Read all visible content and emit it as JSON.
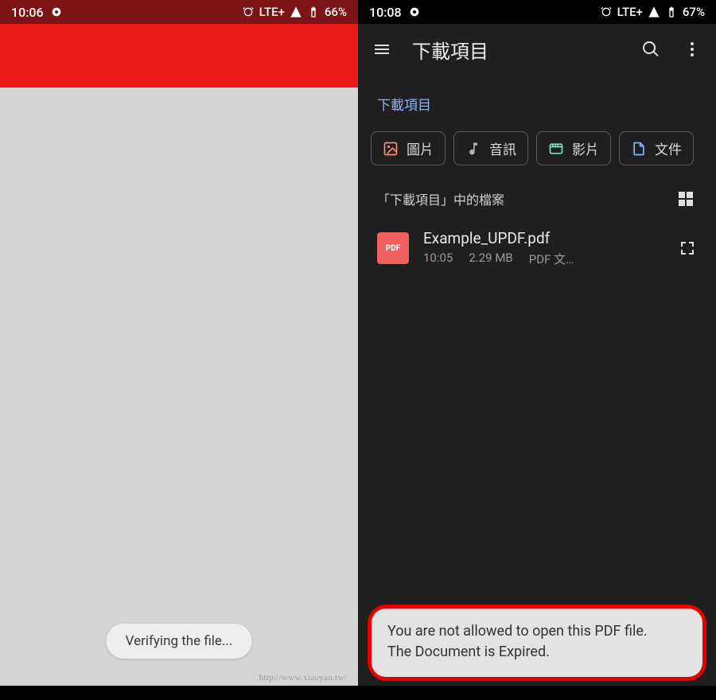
{
  "left": {
    "status": {
      "time": "10:06",
      "network": "LTE+",
      "battery": "66%"
    },
    "toast": "Verifying the file..."
  },
  "right": {
    "status": {
      "time": "10:08",
      "network": "LTE+",
      "battery": "67%"
    },
    "appbar_title": "下載項目",
    "breadcrumb": "下載項目",
    "chips": [
      {
        "label": "圖片",
        "color": "#ff8a80",
        "icon": "image"
      },
      {
        "label": "音訊",
        "color": "#b0b0b0",
        "icon": "audio"
      },
      {
        "label": "影片",
        "color": "#7eddc4",
        "icon": "video"
      },
      {
        "label": "文件",
        "color": "#8ab4f8",
        "icon": "doc"
      }
    ],
    "section_label": "「下載項目」中的檔案",
    "file": {
      "name": "Example_UPDF.pdf",
      "time": "10:05",
      "size": "2.29 MB",
      "type": "PDF 文…",
      "badge": "PDF"
    },
    "toast_line1": "You are not allowed to open this PDF file.",
    "toast_line2": "The Document is Expired."
  },
  "watermark": "http://www.xiaoyao.tw/"
}
